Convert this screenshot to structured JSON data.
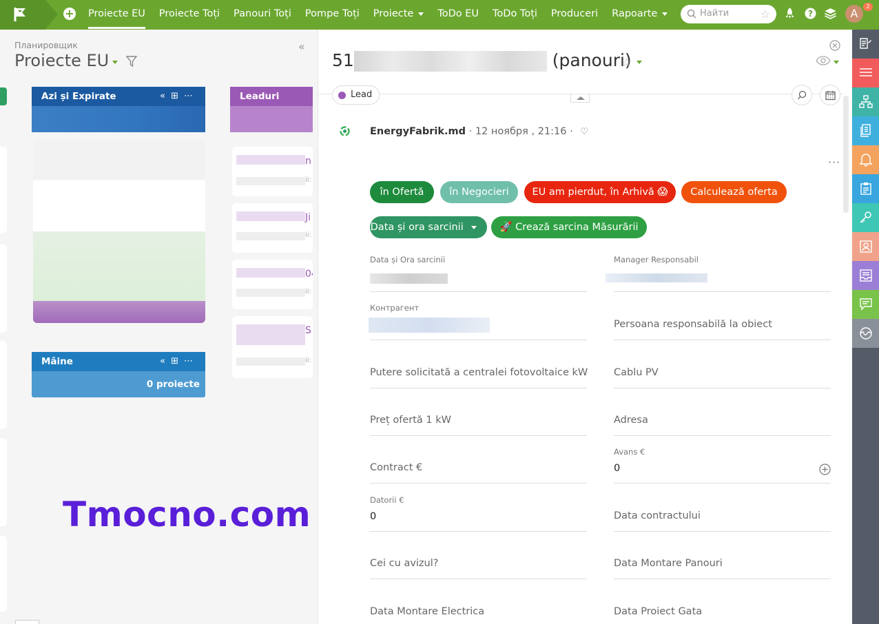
{
  "topbar": {
    "nav": [
      {
        "label": "Proiecte EU",
        "active": true,
        "dropdown": false
      },
      {
        "label": "Proiecte Toți",
        "active": false,
        "dropdown": false
      },
      {
        "label": "Panouri Toți",
        "active": false,
        "dropdown": false
      },
      {
        "label": "Pompe Toți",
        "active": false,
        "dropdown": false
      },
      {
        "label": "Proiecte",
        "active": false,
        "dropdown": true
      },
      {
        "label": "ToDo EU",
        "active": false,
        "dropdown": false
      },
      {
        "label": "ToDo Toți",
        "active": false,
        "dropdown": false
      },
      {
        "label": "Produceri",
        "active": false,
        "dropdown": false
      },
      {
        "label": "Rapoarte",
        "active": false,
        "dropdown": true
      }
    ],
    "search_placeholder": "Найти",
    "avatar_initial": "A",
    "notification_count": "2",
    "colors": {
      "bar": "#6ba72f",
      "logo": "#5a9428"
    }
  },
  "left": {
    "breadcrumb": "Планировщик",
    "title": "Proiecte EU",
    "columns": [
      {
        "title": "Azi și Expirate",
        "color": "#1b5aa0"
      },
      {
        "title": "Leaduri",
        "color": "#9b59b6"
      },
      {
        "title": "Mâine",
        "color": "#1f7dbf",
        "count_label": "0 proiecte"
      }
    ],
    "lead_card_fragments": [
      "n",
      "Ji",
      "04",
      "S"
    ],
    "lead_card_sublabel": "ii:"
  },
  "watermark": "Tmocno.com",
  "detail": {
    "title_suffix": "(panouri)",
    "title_prefix": "51",
    "stage": "Lead",
    "author": "EnergyFabrik.md",
    "date": "12 ноября , 21:16",
    "buttons": [
      {
        "label": "în Ofertă",
        "color": "#1e8a3c"
      },
      {
        "label": "în Negocieri",
        "color": "#6fbfab"
      },
      {
        "label": "EU am pierdut, în Arhivă 😱",
        "color": "#e8260f"
      },
      {
        "label": "Calculează oferta",
        "color": "#f0520c"
      },
      {
        "label": "Data și ora sarcinii",
        "color": "#2f9562"
      },
      {
        "label": "🚀 Crează sarcina Măsurării",
        "color": "#2ea043"
      }
    ],
    "fields": {
      "data_ora_sarcinii": {
        "label": "Data și Ora sarcinii"
      },
      "manager": {
        "label": "Manager Responsabil"
      },
      "contragent": {
        "label": "Контрагент"
      },
      "persoana": {
        "placeholder": "Persoana responsabilă la obiect"
      },
      "putere": {
        "placeholder": "Putere solicitată a centralei fotovoltaice kW"
      },
      "cablu": {
        "placeholder": "Cablu PV"
      },
      "pret": {
        "placeholder": "Preț ofertă 1 kW"
      },
      "adresa": {
        "placeholder": "Adresa"
      },
      "contract": {
        "placeholder": "Contract €"
      },
      "avans": {
        "label": "Avans €",
        "value": "0"
      },
      "datorii": {
        "label": "Datorii €",
        "value": "0"
      },
      "data_contract": {
        "placeholder": "Data contractului"
      },
      "avizul": {
        "placeholder": "Cei cu avizul?"
      },
      "montare_panouri": {
        "placeholder": "Data Montare Panouri"
      },
      "montare_electrica": {
        "placeholder": "Data Montare Electrica"
      },
      "proiect_gata": {
        "placeholder": "Data Proiect Gata"
      }
    }
  },
  "rail": {
    "items": [
      {
        "icon": "edit-list-icon",
        "color": "#555c67"
      },
      {
        "icon": "list-icon",
        "color": "#f25b5b"
      },
      {
        "icon": "org-chart-icon",
        "color": "#3fb3a6"
      },
      {
        "icon": "documents-icon",
        "color": "#3fb0de"
      },
      {
        "icon": "bell-icon",
        "color": "#f4a35f"
      },
      {
        "icon": "clipboard-icon",
        "color": "#3aa6e0"
      },
      {
        "icon": "key-icon",
        "color": "#3fc7b5"
      },
      {
        "icon": "contact-icon",
        "color": "#f0a38a"
      },
      {
        "icon": "inbox-icon",
        "color": "#9b7fd6"
      },
      {
        "icon": "chat-icon",
        "color": "#79c34a"
      },
      {
        "icon": "activity-icon",
        "color": "#8a9099"
      }
    ]
  }
}
